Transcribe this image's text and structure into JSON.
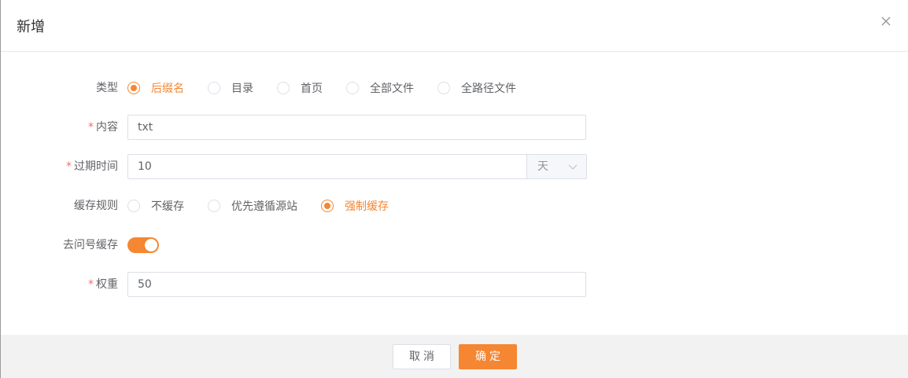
{
  "dialog": {
    "title": "新增",
    "close_icon": "close-icon"
  },
  "form": {
    "type": {
      "label": "类型",
      "options": [
        "后缀名",
        "目录",
        "首页",
        "全部文件",
        "全路径文件"
      ],
      "selected": "后缀名"
    },
    "content": {
      "label": "内容",
      "required": "*",
      "value": "txt"
    },
    "expire": {
      "label": "过期时间",
      "required": "*",
      "value": "10",
      "unit": "天"
    },
    "cache_rule": {
      "label": "缓存规则",
      "options": [
        "不缓存",
        "优先遵循源站",
        "强制缓存"
      ],
      "selected": "强制缓存"
    },
    "strip_query": {
      "label": "去问号缓存",
      "enabled": true
    },
    "weight": {
      "label": "权重",
      "required": "*",
      "value": "50"
    }
  },
  "footer": {
    "cancel_label": "取消",
    "confirm_label": "确定"
  },
  "colors": {
    "accent": "#f58632",
    "required": "#f56c6c",
    "text": "#606266",
    "border": "#dcdfe6"
  }
}
